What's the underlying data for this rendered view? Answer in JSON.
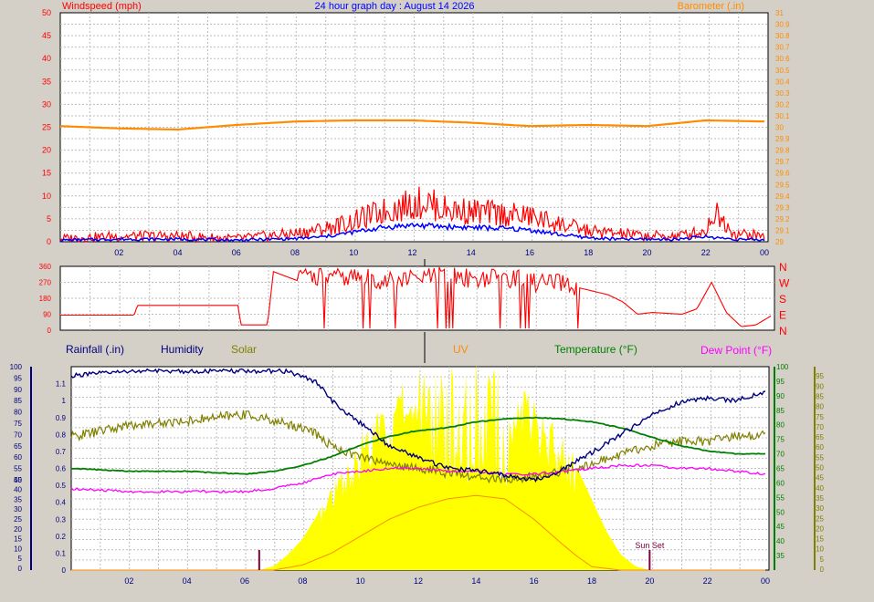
{
  "colors": {
    "background": "#d4d0c8",
    "plot_bg": "#ffffff",
    "grid": "#bdbdbd",
    "wind_gust": "#ff0000",
    "wind_avg": "#0000ff",
    "barometer": "#ff8c00",
    "direction": "#ff0000",
    "rainfall": "#000080",
    "humidity": "#000080",
    "solar": "#808000",
    "uv": "#ff8c00",
    "temperature": "#008000",
    "dew_point": "#ff00ff",
    "solar_fill": "#ffff00",
    "sunset": "#800040"
  },
  "chart_data": [
    {
      "id": "wind",
      "type": "line",
      "title": "24 hour graph day : August 14 2026",
      "left_label": "Windspeed (mph)",
      "right_label": "Barometer (.in)",
      "x_ticks": [
        "02",
        "04",
        "06",
        "08",
        "10",
        "12",
        "14",
        "16",
        "18",
        "20",
        "22",
        "00"
      ],
      "ylim_left": [
        0,
        50
      ],
      "yticks_left": [
        "0",
        "5",
        "10",
        "15",
        "20",
        "25",
        "30",
        "35",
        "40",
        "45",
        "50"
      ],
      "ylim_right": [
        29.0,
        31.0
      ],
      "yticks_right": [
        "29",
        "29.1",
        "29.2",
        "29.3",
        "29.4",
        "29.5",
        "29.6",
        "29.7",
        "29.8",
        "29.9",
        "30",
        "30.1",
        "30.2",
        "30.3",
        "30.4",
        "30.5",
        "30.6",
        "30.7",
        "30.8",
        "30.9",
        "31"
      ],
      "series": [
        {
          "key": "gust",
          "axis": "left",
          "x": [
            0,
            2,
            4,
            6,
            8,
            9,
            10,
            11,
            12,
            12.5,
            13,
            14,
            15,
            16,
            17,
            18,
            19,
            20,
            21,
            22,
            22.3,
            23,
            24
          ],
          "y": [
            0.5,
            1,
            1,
            0.5,
            1.5,
            2.5,
            4,
            6,
            7.5,
            8,
            6.5,
            6,
            5.5,
            5,
            3.5,
            2,
            1.5,
            1,
            1,
            2,
            6,
            1.5,
            1
          ]
        },
        {
          "key": "average",
          "axis": "left",
          "x": [
            0,
            2,
            4,
            6,
            8,
            9,
            10,
            11,
            12,
            13,
            14,
            15,
            16,
            17,
            18,
            19,
            20,
            21,
            22,
            23,
            24
          ],
          "y": [
            0.3,
            0.5,
            0.5,
            0.3,
            0.6,
            1,
            2,
            3,
            3.5,
            3.2,
            3,
            2.8,
            2.5,
            1.5,
            0.8,
            0.5,
            0.5,
            0.5,
            1,
            0.5,
            0.3
          ]
        },
        {
          "key": "barometer",
          "axis": "right",
          "x": [
            0,
            2,
            4,
            6,
            8,
            10,
            12,
            14,
            16,
            18,
            20,
            22,
            24
          ],
          "y": [
            30.01,
            29.99,
            29.98,
            30.02,
            30.05,
            30.06,
            30.06,
            30.04,
            30.01,
            30.02,
            30.01,
            30.06,
            30.05
          ]
        }
      ]
    },
    {
      "id": "direction",
      "type": "line",
      "ylim": [
        0,
        360
      ],
      "yticks_left": [
        "0",
        "90",
        "180",
        "270",
        "360"
      ],
      "compass_labels": [
        "N",
        "W",
        "S",
        "E",
        "N"
      ],
      "series": [
        {
          "key": "direction",
          "x": [
            0,
            2.5,
            2.6,
            6,
            6.1,
            7,
            7.2,
            8,
            8.5,
            9,
            10,
            11,
            12,
            13,
            14,
            15,
            16,
            17,
            18,
            18.5,
            19,
            19.5,
            20,
            21,
            21.5,
            22,
            22.5,
            23,
            23.5,
            24
          ],
          "y": [
            85,
            85,
            140,
            140,
            30,
            30,
            330,
            280,
            310,
            290,
            300,
            280,
            290,
            310,
            290,
            300,
            270,
            260,
            220,
            200,
            160,
            90,
            100,
            90,
            120,
            270,
            100,
            20,
            30,
            80
          ]
        }
      ]
    },
    {
      "id": "multi",
      "type": "line",
      "legend": {
        "rainfall": "Rainfall (.in)",
        "humidity": "Humidity",
        "solar": "Solar",
        "uv": "UV",
        "temperature": "Temperature (°F)",
        "dew_point": "Dew Point (°F)"
      },
      "axis_rain": {
        "ylim": [
          0,
          1.2
        ],
        "ticks": [
          "0",
          "0.1",
          "0.2",
          "0.3",
          "0.4",
          "0.5",
          "0.6",
          "0.7",
          "0.8",
          "0.9",
          "1",
          "1.1"
        ]
      },
      "axis_humidity_upper": {
        "ylim": [
          0,
          100
        ],
        "ticks": [
          "50",
          "55",
          "60",
          "65",
          "70",
          "75",
          "80",
          "85",
          "90",
          "95",
          "100"
        ]
      },
      "axis_humidity_lower": {
        "ticks": [
          "0",
          "5",
          "10",
          "15",
          "20",
          "25",
          "30",
          "35",
          "40",
          "45"
        ]
      },
      "axis_temp": {
        "ylim": [
          30,
          100
        ],
        "ticks": [
          "35",
          "40",
          "45",
          "50",
          "55",
          "60",
          "65",
          "70",
          "75",
          "80",
          "85",
          "90",
          "95",
          "100"
        ]
      },
      "axis_right": {
        "ticks": [
          "0",
          "5",
          "10",
          "15",
          "20",
          "25",
          "30",
          "35",
          "40",
          "45",
          "50",
          "55",
          "60",
          "65",
          "70",
          "75",
          "80",
          "85",
          "90",
          "95"
        ]
      },
      "annotation": "Sun Set",
      "sunrise_hour": 6.5,
      "sunset_hour": 20.0,
      "series": [
        {
          "key": "humidity",
          "x": [
            0,
            2,
            4,
            6,
            7.5,
            8.5,
            9,
            10,
            11,
            12,
            13,
            14,
            15,
            16,
            16.5,
            17,
            18,
            19,
            20,
            21,
            22,
            23,
            24
          ],
          "y": [
            96,
            98,
            98,
            98,
            98,
            93,
            85,
            75,
            65,
            60,
            55,
            54,
            52,
            50,
            51,
            55,
            62,
            70,
            78,
            84,
            86,
            85,
            89
          ]
        },
        {
          "key": "solar",
          "x": [
            0,
            2,
            4,
            6,
            7,
            8,
            8.5,
            9,
            10,
            11,
            12,
            13,
            14,
            15,
            16,
            17,
            18,
            19,
            20,
            21,
            22,
            23,
            24
          ],
          "y": [
            69,
            74,
            76,
            79,
            76,
            73,
            70,
            65,
            60,
            57,
            55,
            53,
            51,
            50,
            51,
            54,
            57,
            61,
            65,
            67,
            67,
            69,
            70
          ]
        },
        {
          "key": "temperature",
          "x": [
            0,
            2,
            4,
            6,
            7,
            8,
            9,
            10,
            11,
            12,
            13,
            14,
            15,
            16,
            17,
            18,
            19,
            20,
            21,
            22,
            23,
            24
          ],
          "y": [
            65,
            64,
            64,
            63,
            64,
            66,
            69,
            73,
            76,
            78,
            79,
            81,
            82,
            82.5,
            82,
            81,
            79,
            76,
            73,
            71,
            70,
            70
          ]
        },
        {
          "key": "dew_point",
          "x": [
            0,
            2,
            4,
            6,
            7,
            8,
            9,
            10,
            11,
            12,
            13,
            14,
            15,
            16,
            17,
            18,
            19,
            20,
            21,
            22,
            23,
            24
          ],
          "y": [
            58,
            57,
            57,
            57,
            58,
            60,
            63,
            64,
            65,
            65,
            64,
            64,
            63,
            63,
            64,
            65,
            66,
            66,
            65,
            65,
            64,
            63
          ]
        },
        {
          "key": "uv",
          "x": [
            0,
            6,
            7,
            8,
            9,
            10,
            11,
            12,
            13,
            14,
            15,
            16,
            17,
            17.5,
            18,
            19,
            24
          ],
          "y": [
            0,
            0,
            0,
            0.03,
            0.1,
            0.2,
            0.3,
            0.37,
            0.42,
            0.44,
            0.42,
            0.3,
            0.15,
            0.08,
            0.02,
            0,
            0
          ]
        },
        {
          "key": "solar_fill",
          "x": [
            0,
            6.5,
            7,
            7.5,
            8,
            8.5,
            9,
            9.5,
            10,
            10.5,
            11,
            11.5,
            12,
            12.5,
            13,
            13.5,
            14,
            14.5,
            15,
            15.5,
            16,
            16.5,
            17,
            17.5,
            18,
            18.5,
            19,
            19.5,
            20,
            24
          ],
          "y": [
            0,
            0,
            1,
            4,
            8,
            14,
            20,
            26,
            31,
            36,
            40,
            43,
            46,
            48,
            49,
            50,
            49,
            48,
            46,
            43,
            40,
            36,
            31,
            26,
            18,
            10,
            4,
            1,
            0,
            0
          ]
        }
      ]
    }
  ]
}
